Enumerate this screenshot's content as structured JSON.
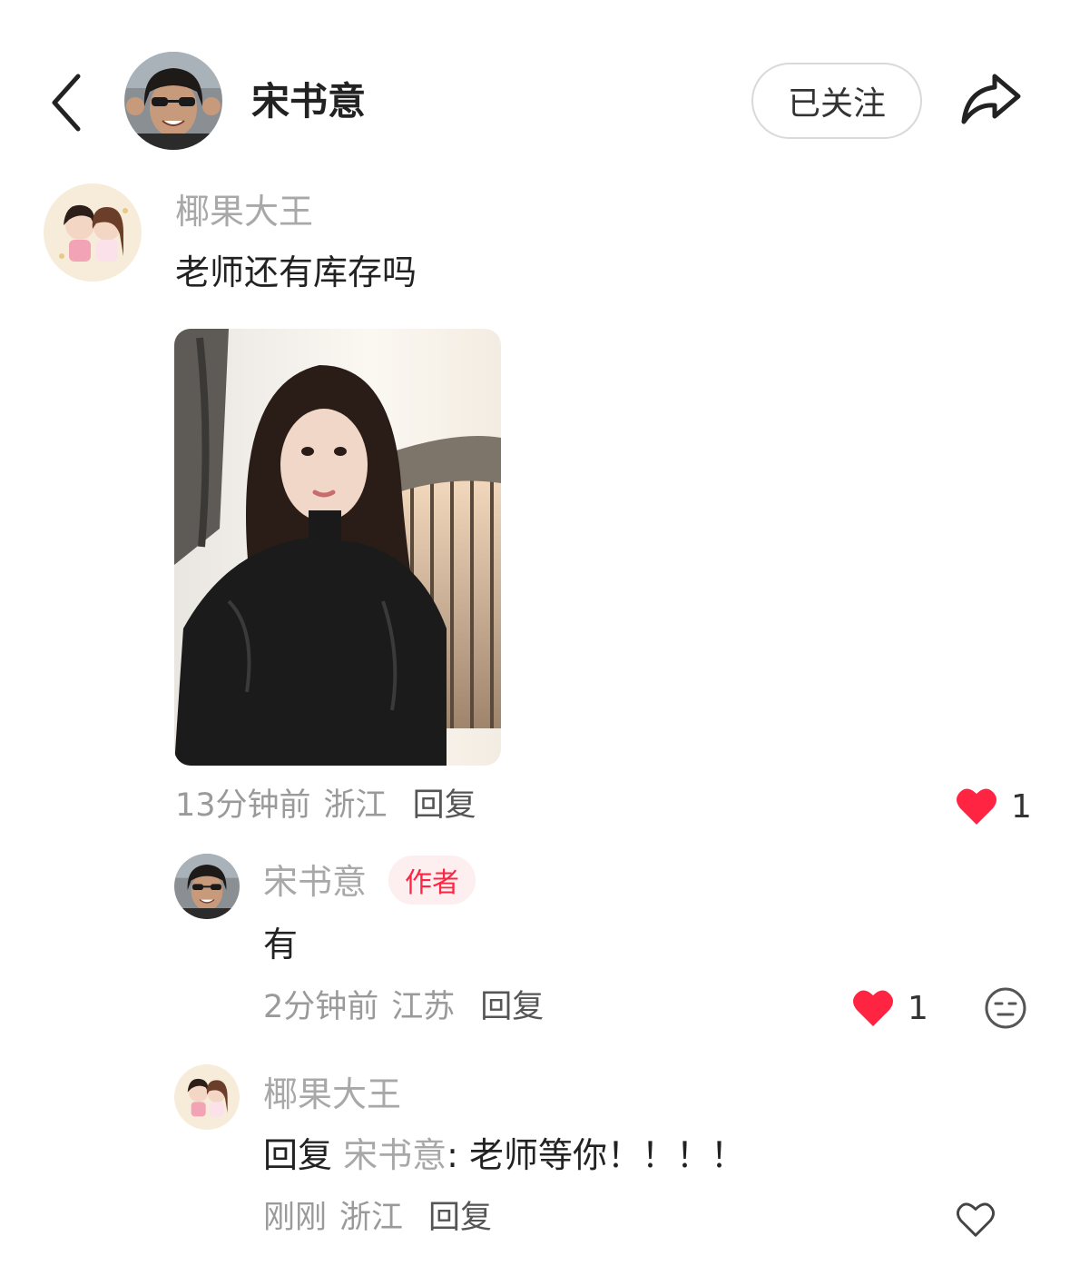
{
  "header": {
    "author_name": "宋书意",
    "follow_label": "已关注"
  },
  "comment": {
    "user": "椰果大王",
    "text": "老师还有库存吗",
    "time": "13分钟前",
    "location": "浙江",
    "reply_label": "回复",
    "likes": "1",
    "liked": true
  },
  "replies": [
    {
      "user": "宋书意",
      "badge": "作者",
      "text": "有",
      "time": "2分钟前",
      "location": "江苏",
      "reply_label": "回复",
      "likes": "1",
      "liked": true
    },
    {
      "user": "椰果大王",
      "reply_prefix": "回复",
      "reply_to": "宋书意",
      "text": ": 老师等你！！！！",
      "time": "刚刚",
      "location": "浙江",
      "reply_label": "回复",
      "liked": false
    }
  ],
  "icons": {
    "back": "chevron-left-icon",
    "share": "share-arrow-icon",
    "like_filled": "heart-filled-icon",
    "like_outline": "heart-outline-icon",
    "emoji": "neutral-face-icon"
  },
  "colors": {
    "accent": "#ff2442",
    "muted_text": "#a8a8a8"
  }
}
